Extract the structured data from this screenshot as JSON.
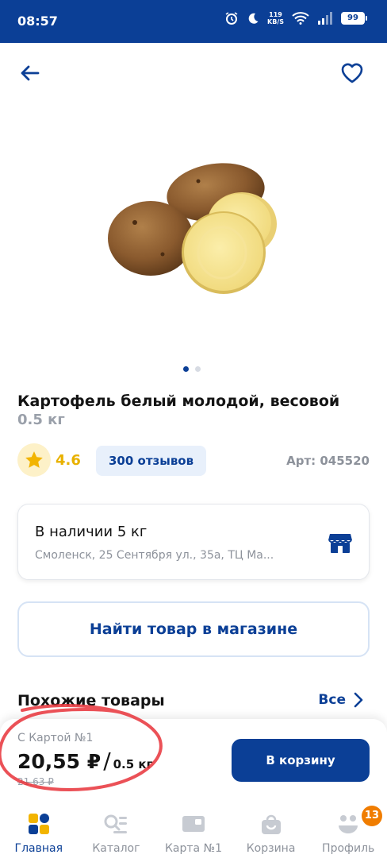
{
  "status": {
    "time": "08:57",
    "net_speed_value": "119",
    "net_speed_unit": "KB/S",
    "battery": "99"
  },
  "product": {
    "title": "Картофель белый молодой, весовой",
    "weight": "0.5 кг",
    "rating": "4.6",
    "reviews": "300 отзывов",
    "article": "Арт: 045520",
    "image_pages": 2,
    "active_image_page": 1
  },
  "availability": {
    "title": "В наличии 5 кг",
    "address": "Смоленск, 25 Сентября ул., 35а, ТЦ Ма...",
    "icon": "store-icon"
  },
  "find_button": "Найти товар в магазине",
  "similar": {
    "title": "Похожие товары",
    "all_label": "Все"
  },
  "price": {
    "card_label": "С Картой №1",
    "main": "20,55 ₽",
    "slash": "/",
    "unit": "0.5 кг",
    "old": "21,63 ₽",
    "cart_button": "В корзину"
  },
  "nav": {
    "items": [
      {
        "label": "Главная",
        "icon": "home-grid-icon",
        "active": true
      },
      {
        "label": "Каталог",
        "icon": "catalog-icon",
        "active": false
      },
      {
        "label": "Карта №1",
        "icon": "card-icon",
        "active": false
      },
      {
        "label": "Корзина",
        "icon": "basket-icon",
        "active": false
      },
      {
        "label": "Профиль",
        "icon": "profile-icon",
        "active": false,
        "badge": "13"
      }
    ]
  },
  "colors": {
    "brand_blue": "#0b3f96",
    "rating_yellow": "#e8b100",
    "badge_orange": "#f07d00",
    "annotation_red": "#e8333a"
  }
}
